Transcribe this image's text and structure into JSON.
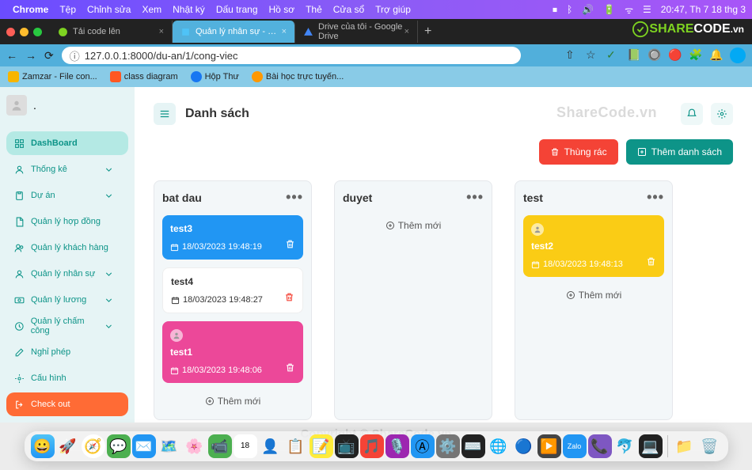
{
  "mac_menu": {
    "app_name": "Chrome",
    "items": [
      "Tệp",
      "Chỉnh sửa",
      "Xem",
      "Nhật ký",
      "Dấu trang",
      "Hồ sơ",
      "Thẻ",
      "Cửa sổ",
      "Trợ giúp"
    ],
    "clock": "20:47, Th 7 18 thg 3"
  },
  "tabs": [
    {
      "title": "Tải code lên",
      "active": false
    },
    {
      "title": "Quản lý nhân sự - ScrumBoard",
      "active": true
    },
    {
      "title": "Drive của tôi - Google Drive",
      "active": false
    }
  ],
  "url": "127.0.0.1:8000/du-an/1/cong-viec",
  "bookmarks": [
    {
      "label": "Zamzar - File con..."
    },
    {
      "label": "class diagram"
    },
    {
      "label": "Hộp Thư"
    },
    {
      "label": "Bài học trực tuyến..."
    }
  ],
  "sidebar": {
    "items": [
      {
        "label": "DashBoard",
        "icon": "dashboard",
        "active": true,
        "chev": false
      },
      {
        "label": "Thống kê",
        "icon": "user",
        "chev": true
      },
      {
        "label": "Dự án",
        "icon": "clipboard",
        "chev": true
      },
      {
        "label": "Quản lý hợp đồng",
        "icon": "file",
        "chev": false
      },
      {
        "label": "Quản lý khách hàng",
        "icon": "users",
        "chev": false
      },
      {
        "label": "Quản lý nhân sự",
        "icon": "user",
        "chev": true
      },
      {
        "label": "Quản lý lương",
        "icon": "money",
        "chev": true
      },
      {
        "label": "Quản lý chấm công",
        "icon": "clock",
        "chev": true
      },
      {
        "label": "Nghỉ phép",
        "icon": "edit",
        "chev": false
      },
      {
        "label": "Cấu hình",
        "icon": "gear",
        "chev": false
      },
      {
        "label": "Check out",
        "icon": "logout",
        "chev": false,
        "checkout": true
      }
    ]
  },
  "page": {
    "title": "Danh sách",
    "trash_btn": "Thùng rác",
    "add_list_btn": "Thêm danh sách",
    "watermark": "ShareCode.vn",
    "copyright": "Copyright © ShareCode.vn"
  },
  "boards": [
    {
      "name": "bat dau",
      "add_label": "Thêm mới",
      "cards": [
        {
          "title": "test3",
          "date": "18/03/2023 19:48:19",
          "color": "blue",
          "avatar": false
        },
        {
          "title": "test4",
          "date": "18/03/2023 19:48:27",
          "color": "white",
          "avatar": false
        },
        {
          "title": "test1",
          "date": "18/03/2023 19:48:06",
          "color": "pink",
          "avatar": true
        }
      ]
    },
    {
      "name": "duyet",
      "add_label": "Thêm mới",
      "cards": []
    },
    {
      "name": "test",
      "add_label": "Thêm mới",
      "cards": [
        {
          "title": "test2",
          "date": "18/03/2023 19:48:13",
          "color": "yellow",
          "avatar": true
        }
      ]
    }
  ],
  "brand": {
    "share": "SHARE",
    "code": "CODE",
    "suffix": ".vn"
  }
}
